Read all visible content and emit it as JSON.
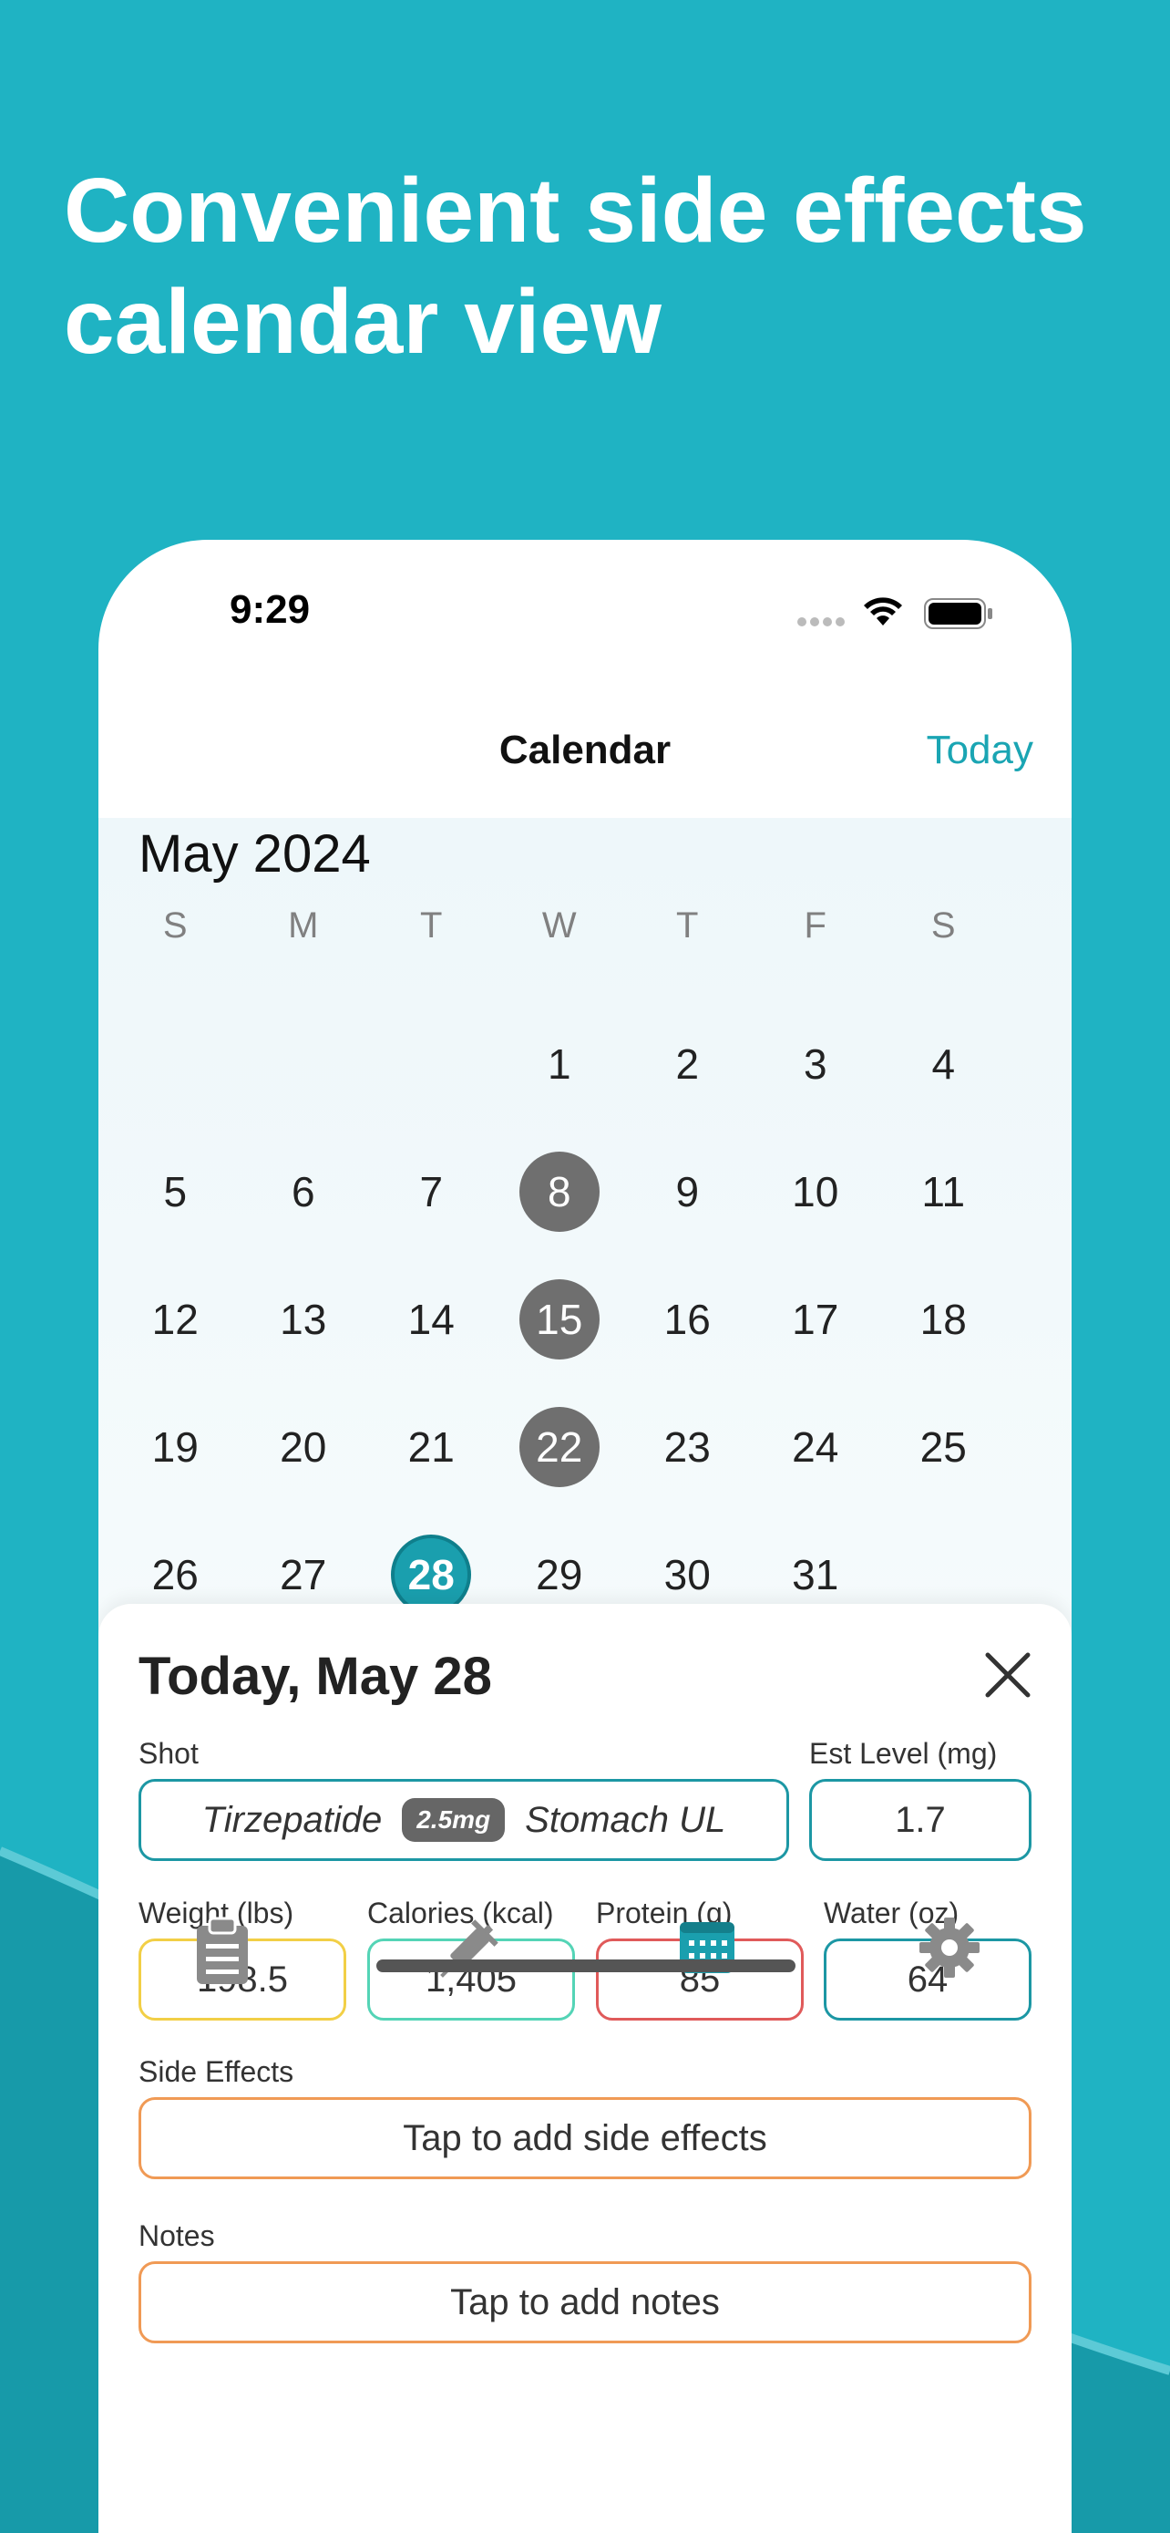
{
  "headline": {
    "line1": "Convenient side effects",
    "line2": "calendar view"
  },
  "status_bar": {
    "time": "9:29",
    "icons": [
      "signal-dots-icon",
      "wifi-icon",
      "battery-icon"
    ]
  },
  "nav": {
    "title": "Calendar",
    "today_button": "Today"
  },
  "calendar": {
    "month": "May 2024",
    "weekdays": [
      "S",
      "M",
      "T",
      "W",
      "T",
      "F",
      "S"
    ],
    "weeks": [
      [
        "",
        "",
        "",
        "1",
        "2",
        "3",
        "4"
      ],
      [
        "5",
        "6",
        "7",
        "8",
        "9",
        "10",
        "11"
      ],
      [
        "12",
        "13",
        "14",
        "15",
        "16",
        "17",
        "18"
      ],
      [
        "19",
        "20",
        "21",
        "22",
        "23",
        "24",
        "25"
      ],
      [
        "26",
        "27",
        "28",
        "29",
        "30",
        "31",
        ""
      ]
    ],
    "shot_days": [
      "8",
      "15",
      "22"
    ],
    "today": "28"
  },
  "sheet": {
    "title": "Today, May 28",
    "shot_label": "Shot",
    "shot_medication": "Tirzepatide",
    "shot_dose": "2.5mg",
    "shot_site": "Stomach UL",
    "level_label": "Est Level (mg)",
    "level_value": "1.7",
    "weight_label": "Weight (lbs)",
    "weight_value": "198.5",
    "calories_label": "Calories (kcal)",
    "calories_value": "1,405",
    "protein_label": "Protein (g)",
    "protein_value": "85",
    "water_label": "Water (oz)",
    "water_value": "64",
    "side_effects_label": "Side Effects",
    "side_effects_placeholder": "Tap to add side effects",
    "notes_label": "Notes",
    "notes_placeholder": "Tap to add notes"
  },
  "tabs": [
    "clipboard-icon",
    "syringe-icon",
    "calendar-icon",
    "gear-icon"
  ],
  "colors": {
    "background": "#1fb3c3",
    "accent": "#1aa5b3",
    "shot_day": "#6f6f6f",
    "weight_border": "#f2cf46",
    "calories_border": "#54d4b6",
    "protein_border": "#e05a5a",
    "notes_border": "#f09a55"
  }
}
